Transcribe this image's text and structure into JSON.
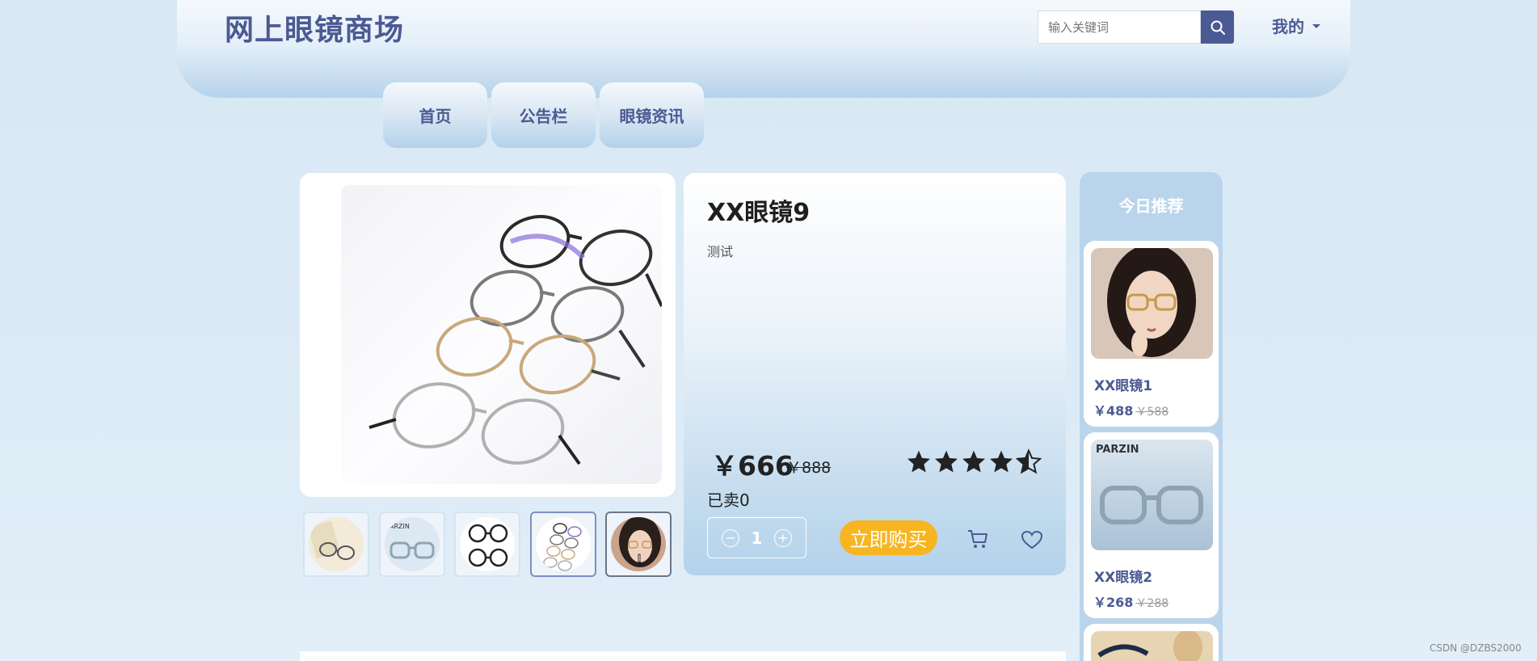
{
  "header": {
    "site_title": "网上眼镜商场",
    "search_placeholder": "输入关键词",
    "user_menu": "我的"
  },
  "nav": {
    "tabs": [
      "首页",
      "公告栏",
      "眼镜资讯"
    ]
  },
  "product": {
    "name": "XX眼镜9",
    "description": "测试",
    "price": "￥666",
    "original_price": "￥888",
    "rating": 4.5,
    "sold": "已卖0",
    "quantity": "1",
    "buy_label": "立即购买"
  },
  "thumbnails": [
    {
      "icon": "glasses-on-notebook"
    },
    {
      "icon": "clear-frame-glasses"
    },
    {
      "icon": "black-frame-glasses"
    },
    {
      "icon": "stacked-glasses"
    },
    {
      "icon": "model-portrait"
    }
  ],
  "recommend": {
    "title": "今日推荐",
    "items": [
      {
        "name": "XX眼镜1",
        "price": "￥488",
        "old_price": "￥588"
      },
      {
        "name": "XX眼镜2",
        "price": "￥268",
        "old_price": "￥288"
      }
    ],
    "brand_text": "PARZIN"
  },
  "watermark": "CSDN @DZBS2000",
  "colors": {
    "brand": "#4b5a93",
    "buy_button": "#f7b521",
    "background": "#d8e8f4"
  }
}
